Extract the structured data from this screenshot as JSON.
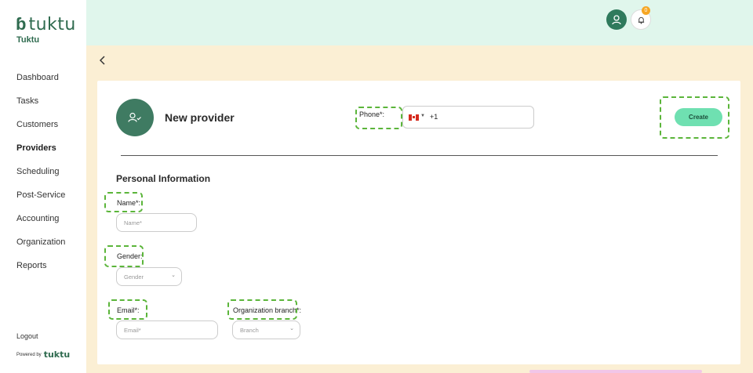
{
  "app": {
    "logo_text": "tuktu",
    "brand_name": "Tuktu"
  },
  "sidebar": {
    "items": [
      {
        "label": "Dashboard"
      },
      {
        "label": "Tasks"
      },
      {
        "label": "Customers"
      },
      {
        "label": "Providers",
        "active": true
      },
      {
        "label": "Scheduling"
      },
      {
        "label": "Post-Service"
      },
      {
        "label": "Accounting"
      },
      {
        "label": "Organization"
      },
      {
        "label": "Reports"
      }
    ],
    "logout": "Logout",
    "powered_by": "Powered by",
    "powered_logo": "tuktu"
  },
  "header": {
    "notification_count": "0",
    "icons": [
      "user-icon",
      "bell-icon"
    ]
  },
  "page": {
    "title": "New provider",
    "back_icon": "chevron-left-icon",
    "header_icon": "add-user-icon"
  },
  "phone": {
    "label": "Phone*:",
    "country_flag": "canada",
    "value": "+1"
  },
  "actions": {
    "create": "Create"
  },
  "form": {
    "section_title": "Personal Information",
    "name": {
      "label": "Name*:",
      "placeholder": "Name*"
    },
    "gender": {
      "label": "Gender:",
      "placeholder": "Gender"
    },
    "email": {
      "label": "Email*:",
      "placeholder": "Email*"
    },
    "branch": {
      "label": "Organization branch*:",
      "placeholder": "Branch"
    }
  },
  "colors": {
    "accent": "#3f7b62",
    "header_bg": "#e0f6ec",
    "content_bg": "#fbefd4",
    "create_btn": "#6fe0b1",
    "highlight": "#5bb53a"
  }
}
